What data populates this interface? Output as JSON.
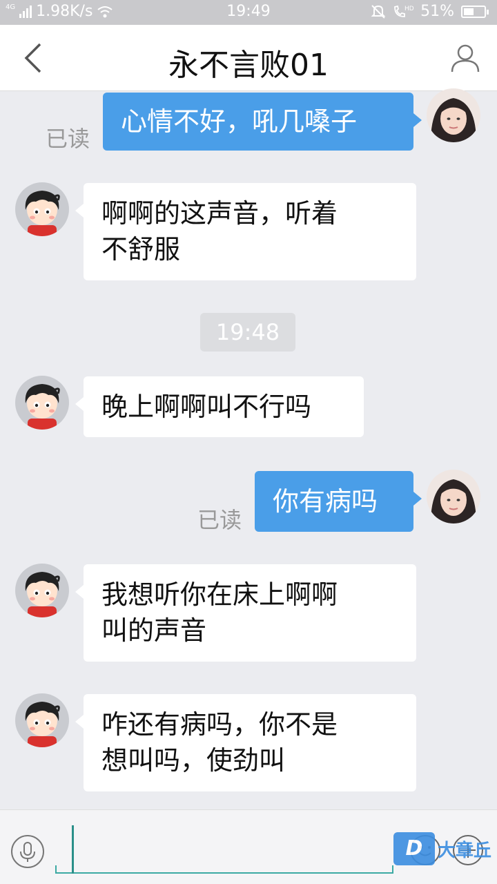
{
  "status_bar": {
    "network_tag": "4G",
    "speed": "1.98K/s",
    "time": "19:49",
    "battery": "51%",
    "battery_level": 0.51
  },
  "header": {
    "title": "永不言败01",
    "back_icon": "chevron-left-icon",
    "profile_icon": "person-icon"
  },
  "messages": [
    {
      "direction": "out",
      "read_label": "已读",
      "text": "心情不好，吼几嗓子"
    },
    {
      "direction": "in",
      "line1": "啊啊的这声音，听着",
      "line2": "不舒服"
    },
    {
      "direction": "time",
      "text": "19:48"
    },
    {
      "direction": "in",
      "text": "晚上啊啊叫不行吗"
    },
    {
      "direction": "out",
      "read_label": "已读",
      "text": "你有病吗"
    },
    {
      "direction": "in",
      "line1": "我想听你在床上啊啊",
      "line2": "叫的声音"
    },
    {
      "direction": "in",
      "line1": "咋还有病吗，你不是",
      "line2": "想叫吗，使劲叫"
    }
  ],
  "input_bar": {
    "text": "",
    "icons": [
      "microphone-icon",
      "emoji-icon",
      "plus-icon"
    ]
  },
  "watermark": {
    "logo": "D",
    "text": "大章丘"
  },
  "colors": {
    "outgoing_bubble": "#4a9ee8",
    "incoming_bubble": "#ffffff",
    "background": "#ebecf0",
    "input_accent": "#3ba9a3"
  }
}
